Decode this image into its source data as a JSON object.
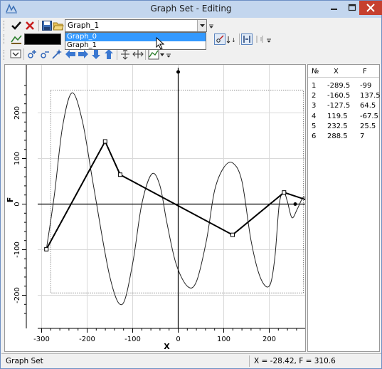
{
  "window": {
    "title": "Graph Set - Editing"
  },
  "toolbar": {
    "graph_select": {
      "selected": "Graph_1"
    },
    "dropdown_options": [
      "Graph_0",
      "Graph_1"
    ],
    "line_color": "#000000"
  },
  "plot": {
    "xlabel": "X",
    "ylabel": "F",
    "x_ticks": [
      "-300",
      "-200",
      "-100",
      "0",
      "100",
      "200"
    ],
    "y_ticks": [
      "200",
      "100",
      "0",
      "-100",
      "-200"
    ],
    "xlim": [
      -330,
      270
    ],
    "ylim": [
      -240,
      270
    ],
    "polyline": [
      [
        -289.5,
        -99
      ],
      [
        -160.5,
        137.5
      ],
      [
        -127.5,
        64.5
      ],
      [
        119.5,
        -67.5
      ],
      [
        232.5,
        25.5
      ],
      [
        288.5,
        7
      ]
    ]
  },
  "table": {
    "columns": [
      "№",
      "X",
      "F"
    ],
    "rows": [
      [
        "1",
        "-289.5",
        "-99"
      ],
      [
        "2",
        "-160.5",
        "137.5"
      ],
      [
        "3",
        "-127.5",
        "64.5"
      ],
      [
        "4",
        "119.5",
        "-67.5"
      ],
      [
        "5",
        "232.5",
        "25.5"
      ],
      [
        "6",
        "288.5",
        "7"
      ]
    ]
  },
  "status": {
    "left": "Graph Set",
    "right": "X = -28.42, F = 310.6"
  }
}
